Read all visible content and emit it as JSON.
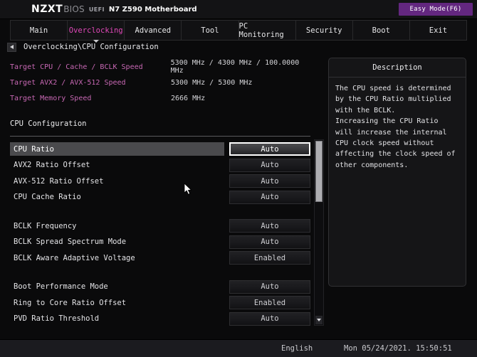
{
  "header": {
    "brand": "NZXT",
    "bios": "BIOS",
    "uefi": "UEFI",
    "board": "N7 Z590 Motherboard",
    "easy_mode_label": "Easy Mode(F6)",
    "accent_color": "#63277f"
  },
  "tabs": [
    {
      "label": "Main",
      "active": false
    },
    {
      "label": "Overclocking",
      "active": true
    },
    {
      "label": "Advanced",
      "active": false
    },
    {
      "label": "Tool",
      "active": false
    },
    {
      "label": "PC Monitoring",
      "active": false
    },
    {
      "label": "Security",
      "active": false
    },
    {
      "label": "Boot",
      "active": false
    },
    {
      "label": "Exit",
      "active": false
    }
  ],
  "breadcrumb": {
    "back_icon": "left-arrow-icon",
    "path": "Overclocking\\CPU Configuration"
  },
  "targets": [
    {
      "label": "Target CPU / Cache / BCLK Speed",
      "value": "5300 MHz / 4300 MHz / 100.0000 MHz"
    },
    {
      "label": "Target AVX2 / AVX-512 Speed",
      "value": "5300 MHz / 5300 MHz"
    },
    {
      "label": "Target Memory Speed",
      "value": "2666 MHz"
    }
  ],
  "section": {
    "title": "CPU Configuration"
  },
  "settings": [
    {
      "label": "CPU  Ratio",
      "value": "Auto",
      "selected": true,
      "gap_before": false
    },
    {
      "label": "AVX2 Ratio Offset",
      "value": "Auto",
      "selected": false,
      "gap_before": false
    },
    {
      "label": "AVX-512 Ratio Offset",
      "value": "Auto",
      "selected": false,
      "gap_before": false
    },
    {
      "label": "CPU  Cache Ratio",
      "value": "Auto",
      "selected": false,
      "gap_before": false
    },
    {
      "label": "BCLK Frequency",
      "value": "Auto",
      "selected": false,
      "gap_before": true
    },
    {
      "label": "BCLK Spread Spectrum Mode",
      "value": "Auto",
      "selected": false,
      "gap_before": false
    },
    {
      "label": "BCLK Aware Adaptive Voltage",
      "value": "Enabled",
      "selected": false,
      "gap_before": false
    },
    {
      "label": "Boot Performance Mode",
      "value": "Auto",
      "selected": false,
      "gap_before": true
    },
    {
      "label": "Ring to Core Ratio Offset",
      "value": "Enabled",
      "selected": false,
      "gap_before": false
    },
    {
      "label": "PVD Ratio Threshold",
      "value": "Auto",
      "selected": false,
      "gap_before": false
    }
  ],
  "scrollbar": {
    "down_icon": "chevron-down-icon"
  },
  "description": {
    "title": "Description",
    "body": "The CPU speed is determined by the CPU Ratio multiplied with the BCLK.\nIncreasing the CPU Ratio will increase the internal CPU clock speed without affecting the clock speed of other components."
  },
  "footer": {
    "language": "English",
    "datetime": "Mon 05/24/2021. 15:50:51"
  }
}
